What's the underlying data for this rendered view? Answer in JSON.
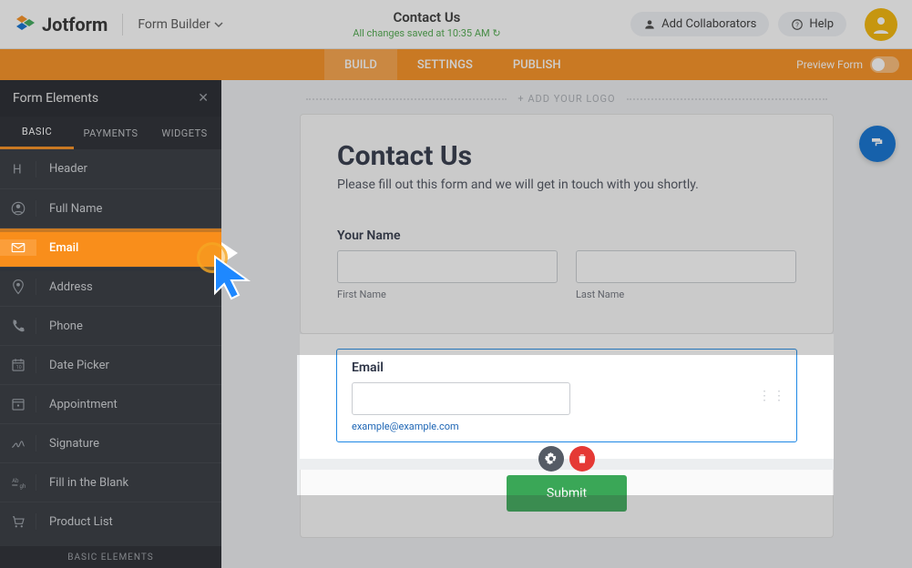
{
  "brand": "Jotform",
  "form_builder_label": "Form Builder",
  "top_center": {
    "title": "Contact Us",
    "save_status": "All changes saved at 10:35 AM ↻"
  },
  "top_buttons": {
    "collab": "Add Collaborators",
    "help": "Help"
  },
  "main_tabs": [
    "BUILD",
    "SETTINGS",
    "PUBLISH"
  ],
  "main_tabs_active_index": 0,
  "preview_label": "Preview Form",
  "sidebar": {
    "title": "Form Elements",
    "tabs": [
      "BASIC",
      "PAYMENTS",
      "WIDGETS"
    ],
    "tabs_active_index": 0,
    "items": [
      "Header",
      "Full Name",
      "Email",
      "Address",
      "Phone",
      "Date Picker",
      "Appointment",
      "Signature",
      "Fill in the Blank",
      "Product List"
    ],
    "selected_index": 2,
    "footer": "BASIC ELEMENTS"
  },
  "form": {
    "heading": "Contact Us",
    "subheading": "Please fill out this form and we will get in touch with you shortly.",
    "add_logo": "+ ADD YOUR LOGO",
    "your_name_label": "Your Name",
    "first_name_sub": "First Name",
    "last_name_sub": "Last Name",
    "email_label": "Email",
    "email_hint": "example@example.com",
    "submit": "Submit"
  }
}
